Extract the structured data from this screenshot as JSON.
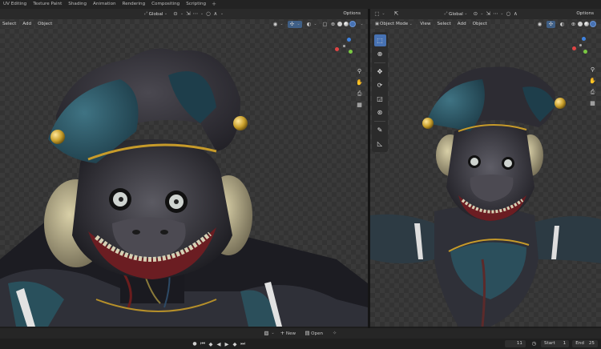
{
  "workspace_tabs": [
    "UV Editing",
    "Texture Paint",
    "Shading",
    "Animation",
    "Rendering",
    "Compositing",
    "Scripting"
  ],
  "workspace_add": "+",
  "left_viewport": {
    "menus": [
      "Select",
      "Add",
      "Object"
    ],
    "orientation": "Global",
    "options": "Options"
  },
  "right_viewport": {
    "mode": "Object Mode",
    "menus": [
      "View",
      "Select",
      "Add",
      "Object"
    ],
    "orientation": "Global",
    "options": "Options"
  },
  "bottom": {
    "new_label": "New",
    "open_label": "Open",
    "current_frame": "11",
    "start_label": "Start",
    "start_value": "1",
    "end_label": "End",
    "end_value": "25"
  },
  "colors": {
    "accent": "#4772b3",
    "axis_x": "#e04444",
    "axis_y": "#7ac943",
    "axis_z": "#3f83e0"
  }
}
